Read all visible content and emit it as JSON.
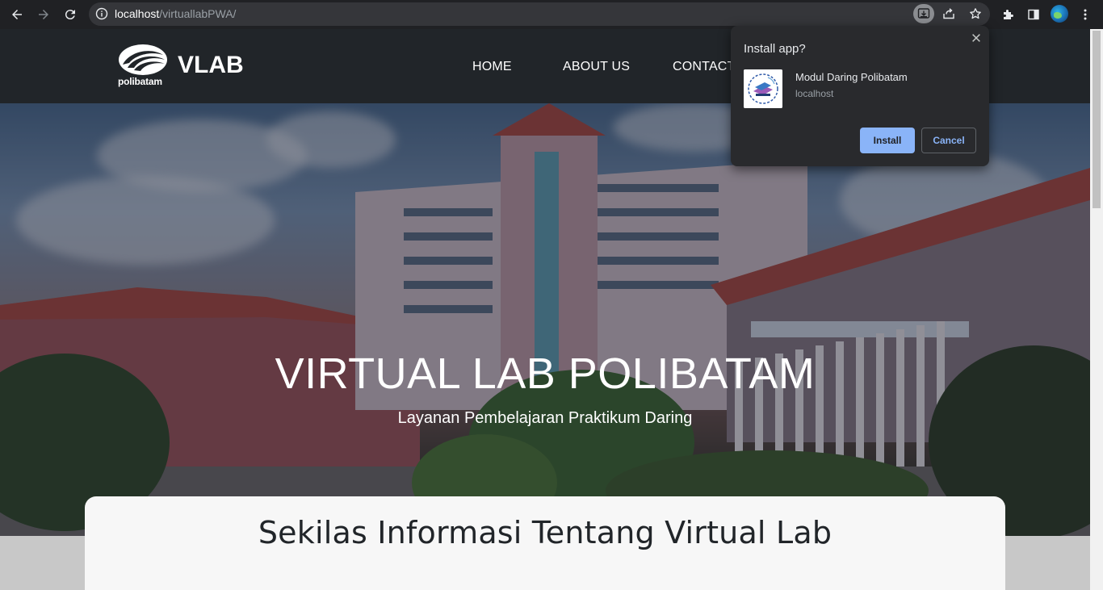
{
  "browser": {
    "url_host": "localhost",
    "url_path": "/virtuallabPWA/"
  },
  "site": {
    "logo_text": "polibatam",
    "brand": "VLAB",
    "menu": [
      "HOME",
      "ABOUT US",
      "CONTACT"
    ]
  },
  "hero": {
    "title": "VIRTUAL LAB POLIBATAM",
    "subtitle": "Layanan Pembelajaran Praktikum Daring"
  },
  "info": {
    "title": "Sekilas Informasi Tentang Virtual Lab"
  },
  "install_popup": {
    "title": "Install app?",
    "app_name": "Modul Daring Polibatam",
    "app_host": "localhost",
    "install_label": "Install",
    "cancel_label": "Cancel"
  },
  "colors": {
    "chrome_bg": "#202124",
    "nav_bg": "#212529",
    "install_button": "#8ab4f8",
    "popup_bg": "#292a2d"
  },
  "icons": {
    "back": "arrow-left-icon",
    "forward": "arrow-right-icon",
    "reload": "reload-icon",
    "site_info": "info-icon",
    "install": "install-app-icon",
    "share": "share-icon",
    "bookmark": "star-icon",
    "extensions": "puzzle-icon",
    "side_panel": "side-panel-icon",
    "menu": "kebab-menu-icon",
    "close": "close-icon"
  }
}
